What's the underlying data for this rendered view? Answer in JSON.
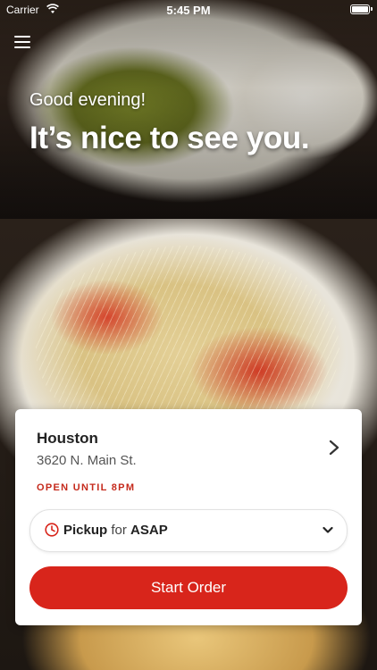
{
  "status_bar": {
    "carrier": "Carrier",
    "time": "5:45 PM"
  },
  "header": {
    "greeting": "Good evening!",
    "headline": "It’s nice to see you."
  },
  "location": {
    "name": "Houston",
    "address": "3620 N. Main St.",
    "hours": "OPEN UNTIL 8PM"
  },
  "order": {
    "mode": "Pickup",
    "connector": "for",
    "time": "ASAP",
    "start_label": "Start Order"
  },
  "colors": {
    "accent": "#d8251b",
    "hours_text": "#c52a1c"
  },
  "icons": {
    "menu": "hamburger-icon",
    "wifi": "wifi-icon",
    "battery": "battery-icon",
    "location_chevron": "chevron-right-icon",
    "pickup_clock": "clock-icon",
    "pickup_dropdown": "chevron-down-icon"
  }
}
